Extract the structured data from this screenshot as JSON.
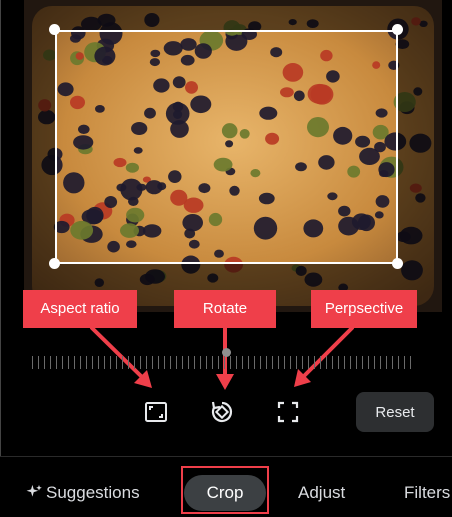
{
  "callouts": {
    "aspect": "Aspect ratio",
    "rotate": "Rotate",
    "perspective": "Perpsective"
  },
  "tools": {
    "aspect_icon": "aspect-ratio-icon",
    "rotate_icon": "rotate-icon",
    "perspective_icon": "perspective-icon",
    "reset_label": "Reset"
  },
  "tabs": {
    "suggestions": "Suggestions",
    "crop": "Crop",
    "adjust": "Adjust",
    "filters": "Filters"
  },
  "colors": {
    "callout": "#ef3f4a",
    "active_tab": "#3c4043",
    "reset_bg": "#2d2f31"
  }
}
